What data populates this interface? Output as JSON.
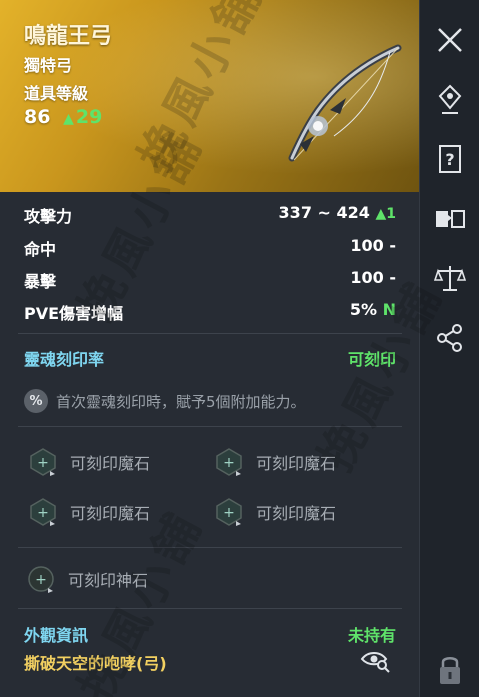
{
  "item": {
    "name": "鳴龍王弓",
    "type": "獨特弓",
    "ilvl_label": "道具等級",
    "ilvl_base": "86",
    "ilvl_bonus": "29"
  },
  "stats": [
    {
      "label": "攻擊力",
      "value": "337 ~ 424",
      "delta": "1"
    },
    {
      "label": "命中",
      "value": "100 -"
    },
    {
      "label": "暴擊",
      "value": "100 -"
    },
    {
      "label": "PVE傷害增幅",
      "value": "5%",
      "badge": "N"
    }
  ],
  "soul": {
    "title": "靈魂刻印率",
    "status": "可刻印",
    "note": "首次靈魂刻印時，賦予5個附加能力。",
    "note_icon": "%"
  },
  "sockets": {
    "magic": [
      "可刻印魔石",
      "可刻印魔石",
      "可刻印魔石",
      "可刻印魔石"
    ],
    "divine": "可刻印神石"
  },
  "appearance": {
    "label": "外觀資訊",
    "status": "未持有",
    "skin": "撕破天空的咆哮(弓)"
  },
  "watermark": "挽風小舖",
  "colors": {
    "header_gold": "#c9961d",
    "highlight_green": "#5fe36a",
    "label_cyan": "#7fd6f0",
    "skin_yellow": "#f2d061",
    "panel_bg": "#272c34"
  },
  "icons": {
    "sidebar": [
      "close-icon",
      "location-pin-icon",
      "question-book-icon",
      "compare-cards-icon",
      "scales-icon",
      "share-icon"
    ],
    "lock": "lock-icon",
    "preview": "eye-search-icon"
  }
}
